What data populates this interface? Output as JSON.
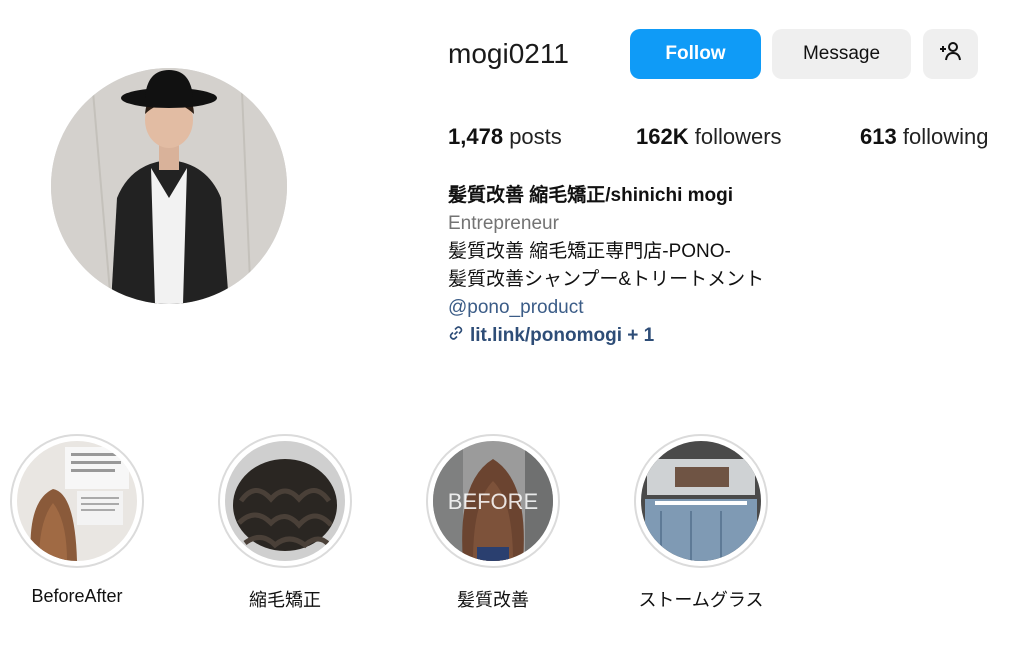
{
  "profile": {
    "username": "mogi0211",
    "follow_label": "Follow",
    "message_label": "Message",
    "add_user_icon": "add-user-icon"
  },
  "stats": {
    "posts_count": "1,478",
    "posts_label": "posts",
    "followers_count": "162K",
    "followers_label": "followers",
    "following_count": "613",
    "following_label": "following"
  },
  "bio": {
    "name": "髪質改善 縮毛矯正/shinichi mogi",
    "category": "Entrepreneur",
    "line1": "髪質改善 縮毛矯正専門店-PONO-",
    "line2": "髪質改善シャンプー&トリートメント",
    "mention": "@pono_product",
    "link": "lit.link/ponomogi + 1",
    "link_icon": "link-icon"
  },
  "highlights": [
    {
      "label": "BeforeAfter"
    },
    {
      "label": "縮毛矯正"
    },
    {
      "label": "髪質改善",
      "overlay_text": "BEFORE"
    },
    {
      "label": "ストームグラス"
    }
  ],
  "colors": {
    "follow_button": "#0f9bf7",
    "secondary_button": "#efefef",
    "mention": "#3b5c87",
    "category": "#737373"
  }
}
